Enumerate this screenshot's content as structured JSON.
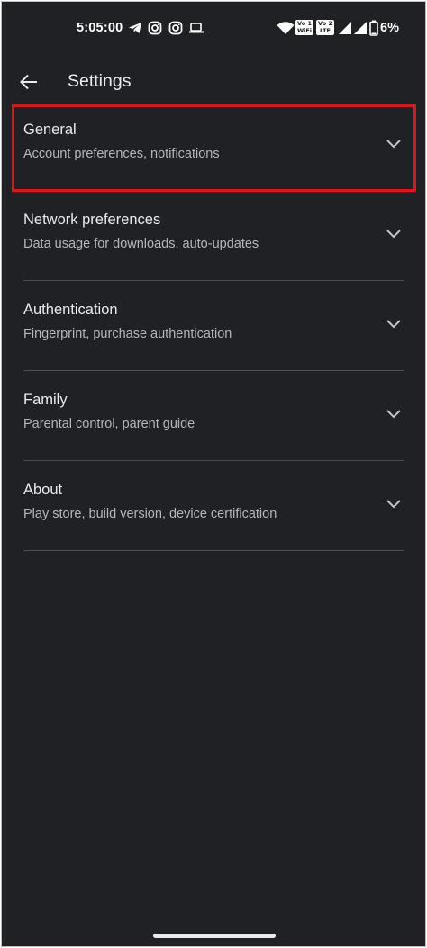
{
  "status_bar": {
    "time": "5:05:00",
    "icons": [
      "telegram-icon",
      "instagram-icon",
      "instagram-icon",
      "cast-icon"
    ],
    "wifi_badge": [
      "Vo",
      "WiFi",
      "1"
    ],
    "lte_badge": [
      "Vo",
      "LTE",
      "2"
    ],
    "battery": "6%"
  },
  "app_bar": {
    "back_icon": "arrow-left-icon",
    "title": "Settings"
  },
  "settings": {
    "items": [
      {
        "title": "General",
        "subtitle": "Account preferences, notifications"
      },
      {
        "title": "Network preferences",
        "subtitle": "Data usage for downloads, auto-updates"
      },
      {
        "title": "Authentication",
        "subtitle": "Fingerprint, purchase authentication"
      },
      {
        "title": "Family",
        "subtitle": "Parental control, parent guide"
      },
      {
        "title": "About",
        "subtitle": "Play store, build version, device certification"
      }
    ]
  },
  "colors": {
    "background": "#202124",
    "text_primary": "#e8eaed",
    "text_secondary": "#b3b6ba",
    "highlight": "#e0151b"
  }
}
